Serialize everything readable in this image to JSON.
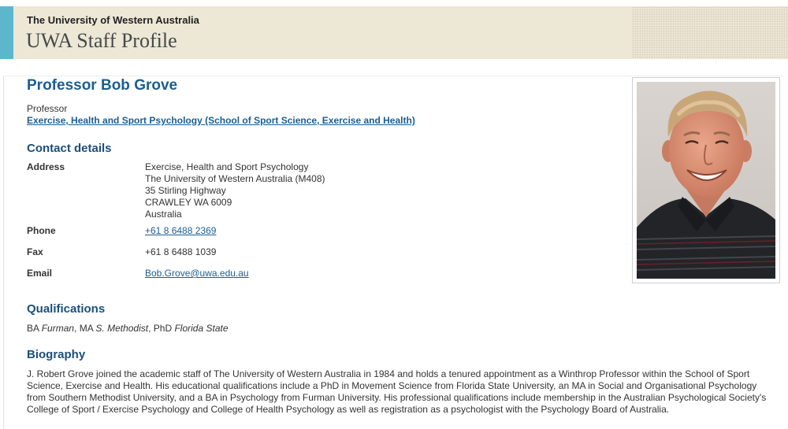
{
  "banner": {
    "university": "The University of Western Australia",
    "site_title": "UWA Staff Profile"
  },
  "profile": {
    "name": "Professor Bob Grove",
    "position": "Professor",
    "department": "Exercise, Health and Sport Psychology (School of Sport Science, Exercise and Health)",
    "photo_icon": "staff-photo"
  },
  "contact": {
    "heading": "Contact details",
    "address_label": "Address",
    "address_lines": [
      "Exercise, Health and Sport Psychology",
      "The University of Western Australia (M408)",
      "35 Stirling Highway",
      "CRAWLEY WA 6009",
      "Australia"
    ],
    "phone_label": "Phone",
    "phone": "+61 8 6488 2369",
    "fax_label": "Fax",
    "fax": "+61 8 6488 1039",
    "email_label": "Email",
    "email": "Bob.Grove@uwa.edu.au"
  },
  "qualifications": {
    "heading": "Qualifications",
    "items": [
      {
        "degree": "BA",
        "institution": "Furman"
      },
      {
        "degree": "MA",
        "institution": "S. Methodist"
      },
      {
        "degree": "PhD",
        "institution": "Florida State"
      }
    ]
  },
  "biography": {
    "heading": "Biography",
    "text": "J. Robert Grove joined the academic staff of The University of Western Australia in 1984 and holds a tenured appointment as a Winthrop Professor within the School of Sport Science, Exercise and Health. His educational qualifications include a PhD in Movement Science from Florida State University, an MA in Social and Organisational Psychology from Southern Methodist University, and a BA in Psychology from Furman University. His professional qualifications include membership in the Australian Psychological Society's College of Sport / Exercise Psychology and College of Health Psychology as well as registration as a psychologist with the Psychology Board of Australia."
  },
  "colors": {
    "banner_bg": "#ede7d6",
    "banner_accent": "#5db7cc",
    "heading_blue": "#1b4f7b",
    "link_blue": "#1b5e91"
  }
}
